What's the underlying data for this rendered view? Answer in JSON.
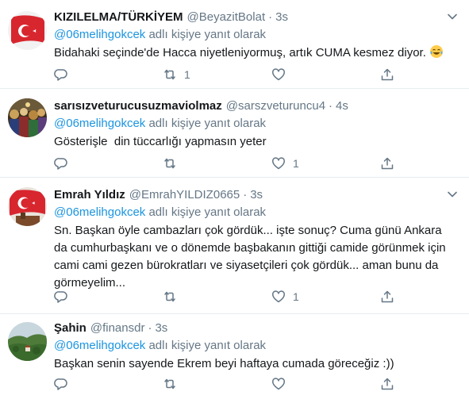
{
  "tweets": [
    {
      "name": "KIZILELMA/TÜRKİYEM",
      "handle": "@BeyazitBolat",
      "separator": "·",
      "time": "3s",
      "reply_mention": "@06melihgokcek",
      "reply_suffix": " adlı kişiye yanıt olarak",
      "text": "Bidahaki seçinde'de Hacca niyetleniyormuş, artık CUMA kesmez diyor.",
      "emoji": "tears-of-joy",
      "retweets": "1",
      "likes": ""
    },
    {
      "name": "sarısızveturucusuzmaviolmaz",
      "handle": "@sarszveturuncu4",
      "separator": "·",
      "time": "4s",
      "reply_mention": "@06melihgokcek",
      "reply_suffix": " adlı kişiye yanıt olarak",
      "text": "Gösterişle  din tüccarlığı yapmasın yeter",
      "retweets": "",
      "likes": "1"
    },
    {
      "name": "Emrah Yıldız",
      "handle": "@EmrahYILDIZ0665",
      "separator": "·",
      "time": "3s",
      "reply_mention": "@06melihgokcek",
      "reply_suffix": " adlı kişiye yanıt olarak",
      "text": "Sn. Başkan öyle cambazları çok gördük... işte sonuç? Cuma günü Ankara\nda cumhurbaşkanı ve o dönemde başbakanın gittiği camide görünmek için\ncami cami gezen bürokratları ve siyasetçileri çok gördük... aman bunu da\ngörmeyelim...",
      "retweets": "",
      "likes": "1"
    },
    {
      "name": "Şahin",
      "handle": "@finansdr",
      "separator": "·",
      "time": "3s",
      "reply_mention": "@06melihgokcek",
      "reply_suffix": " adlı kişiye yanıt olarak",
      "text": "Başkan senin sayende Ekrem beyi haftaya cumada göreceğiz :))",
      "retweets": "",
      "likes": ""
    }
  ],
  "icons": {
    "reply": "reply-icon",
    "retweet": "retweet-icon",
    "like": "like-icon",
    "share": "share-icon",
    "caret": "chevron-down-icon"
  },
  "colors": {
    "text": "#14171a",
    "secondary": "#657786",
    "link": "#1b95e0",
    "divider": "#e6ecf0"
  }
}
